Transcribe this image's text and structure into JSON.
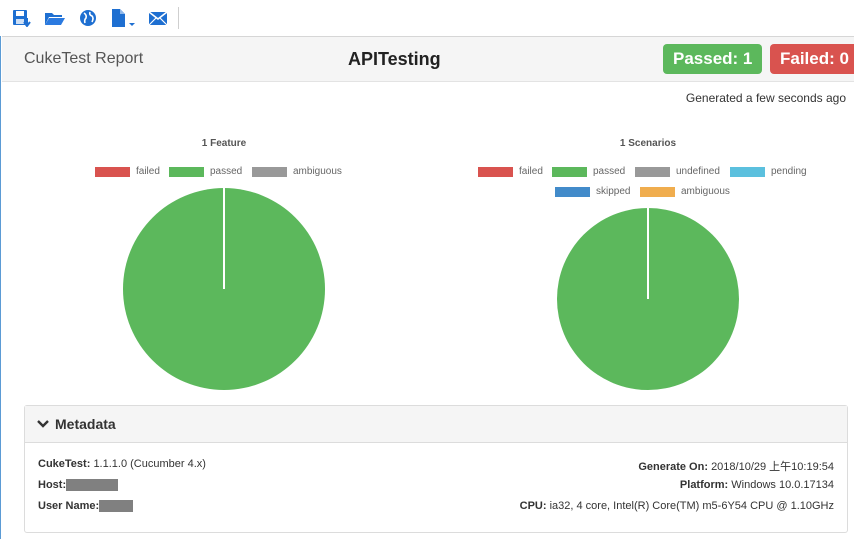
{
  "toolbar": {
    "buttons": [
      {
        "icon": "save-icon",
        "label": ""
      },
      {
        "icon": "open-folder-icon",
        "label": ""
      },
      {
        "icon": "globe-icon",
        "label": ""
      },
      {
        "icon": "new-file-dropdown-icon",
        "label": ""
      },
      {
        "icon": "mail-icon",
        "label": ""
      }
    ]
  },
  "header": {
    "brand": "CukeTest Report",
    "title": "APITesting",
    "passed_label": "Passed: 1",
    "failed_label": "Failed: 0"
  },
  "generated": "Generated a few seconds ago",
  "colors": {
    "failed": "#d9534f",
    "passed": "#5cb85c",
    "ambiguous": "#999999",
    "undefined": "#999999",
    "pending": "#5bc0de",
    "skipped": "#428bca",
    "ambiguous_scen": "#f0ad4e"
  },
  "chart_data": [
    {
      "type": "pie",
      "title": "1 Feature",
      "categories": [
        "failed",
        "passed",
        "ambiguous"
      ],
      "values": [
        0,
        1,
        0
      ],
      "legend": [
        "failed",
        "passed",
        "ambiguous"
      ]
    },
    {
      "type": "pie",
      "title": "1 Scenarios",
      "categories": [
        "failed",
        "passed",
        "undefined",
        "pending",
        "skipped",
        "ambiguous"
      ],
      "values": [
        0,
        1,
        0,
        0,
        0,
        0
      ],
      "legend": [
        "failed",
        "passed",
        "undefined",
        "pending",
        "skipped",
        "ambiguous"
      ]
    }
  ],
  "metadata": {
    "heading": "Metadata",
    "cuketest_label": "CukeTest:",
    "cuketest_value": "1.1.1.0 (Cucumber 4.x)",
    "host_label": "Host:",
    "username_label": "User Name:",
    "generate_label": "Generate On:",
    "generate_value": "2018/10/29 上午10:19:54",
    "platform_label": "Platform:",
    "platform_value": "Windows 10.0.17134",
    "cpu_label": "CPU:",
    "cpu_value": "ia32, 4 core, Intel(R) Core(TM) m5-6Y54 CPU @ 1.10GHz"
  }
}
